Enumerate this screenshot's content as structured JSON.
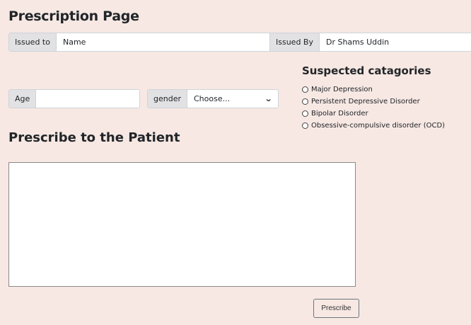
{
  "page": {
    "title": "Prescription Page"
  },
  "issued_to": {
    "label": "Issued to",
    "value": "Name"
  },
  "issued_by": {
    "label": "Issued By",
    "value": "Dr Shams Uddin"
  },
  "age": {
    "label": "Age",
    "value": ""
  },
  "gender": {
    "label": "gender",
    "selected": "Choose...",
    "icon": "chevron-down-icon"
  },
  "categories": {
    "title": "Suspected catagories",
    "options": [
      "Major Depression",
      "Persistent Depressive Disorder",
      "Bipolar Disorder",
      "Obsessive-compulsive disorder (OCD)"
    ]
  },
  "prescribe": {
    "title": "Prescribe to the Patient",
    "text": "",
    "button_label": "Prescribe"
  },
  "colors": {
    "background": "#f7e8e3",
    "addon": "#e2e1e4"
  }
}
